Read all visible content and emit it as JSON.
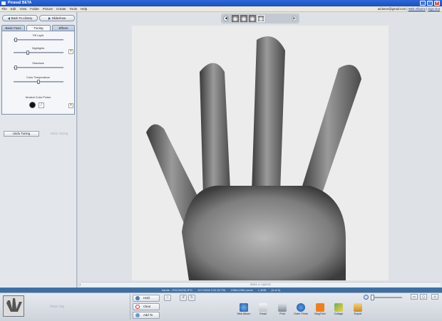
{
  "window": {
    "title": "Picasa2 BETA"
  },
  "menu": [
    "File",
    "Edit",
    "View",
    "Folder",
    "Picture",
    "Create",
    "Tools",
    "Help"
  ],
  "account": {
    "email": "ad.keen@gmail.com",
    "sep": "|",
    "web_albums": "Web Albums",
    "sign_out": "Sign Out"
  },
  "nav": {
    "back": "Back To Library",
    "slideshow": "Slideshow"
  },
  "tabs": {
    "basic": "Basic Fixes",
    "tuning": "Tuning",
    "effects": "Effects"
  },
  "tuning": {
    "fill_light": {
      "label": "Fill Light",
      "level": 0.02
    },
    "highlights": {
      "label": "Highlights",
      "level": 0.28
    },
    "shadows": {
      "label": "Shadows",
      "level": 0.02
    },
    "color_temperature": {
      "label": "Color Temperature",
      "level": 0.5
    },
    "neutral_picker": {
      "label": "Neutral Color Picker"
    },
    "undo": "Undo Tuning",
    "redo": "Redo Tuning"
  },
  "viewer": {
    "caption_placeholder": "Make a caption!",
    "icons": [
      "prev-arrow-icon",
      "next-arrow-icon"
    ]
  },
  "status": {
    "filename": "hands - DSC04436.JPG",
    "date": "12/7/2006 2:52:22 PM",
    "dims": "1956x1956 pixels",
    "size": "1.4MB",
    "index": "(6 of 6)"
  },
  "tray": {
    "label": "Photo Tray",
    "hold": "Hold",
    "clear": "Clear",
    "add_to": "Add To"
  },
  "actions": [
    "Web Album",
    "Email",
    "Print",
    "Order Prints",
    "BlogThis!",
    "Collage",
    "Export"
  ],
  "colors": {
    "accent": "#2d68d8",
    "status": "#3e6fa3"
  }
}
